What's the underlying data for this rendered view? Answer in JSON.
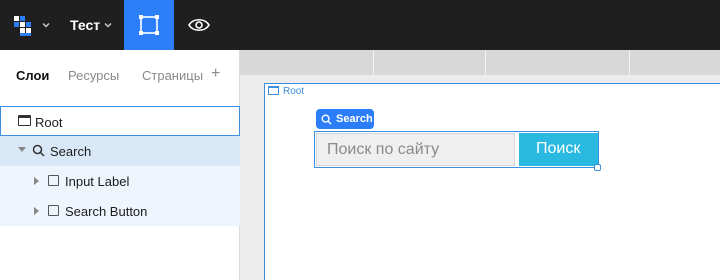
{
  "toolbar": {
    "project_name": "Тест"
  },
  "left_panel": {
    "tabs": [
      {
        "label": "Слои",
        "active": true
      },
      {
        "label": "Ресурсы",
        "active": false
      },
      {
        "label": "Страницы",
        "active": false
      }
    ],
    "add_label": "+",
    "layers": [
      {
        "label": "Root",
        "icon": "frame-icon",
        "selected": true
      },
      {
        "label": "Search",
        "icon": "search-icon",
        "expanded": true
      },
      {
        "label": "Input Label",
        "icon": "box-icon",
        "expanded": false
      },
      {
        "label": "Search Button",
        "icon": "box-icon",
        "expanded": false
      }
    ]
  },
  "canvas": {
    "root_label": "Root",
    "component_badge": "Search",
    "search_placeholder": "Поиск по сайту",
    "search_button_label": "Поиск"
  },
  "colors": {
    "toolbar_bg": "#1f1f20",
    "accent": "#2c7ef8",
    "selection": "#3b8fdc",
    "search_button": "#2ab9e0"
  }
}
